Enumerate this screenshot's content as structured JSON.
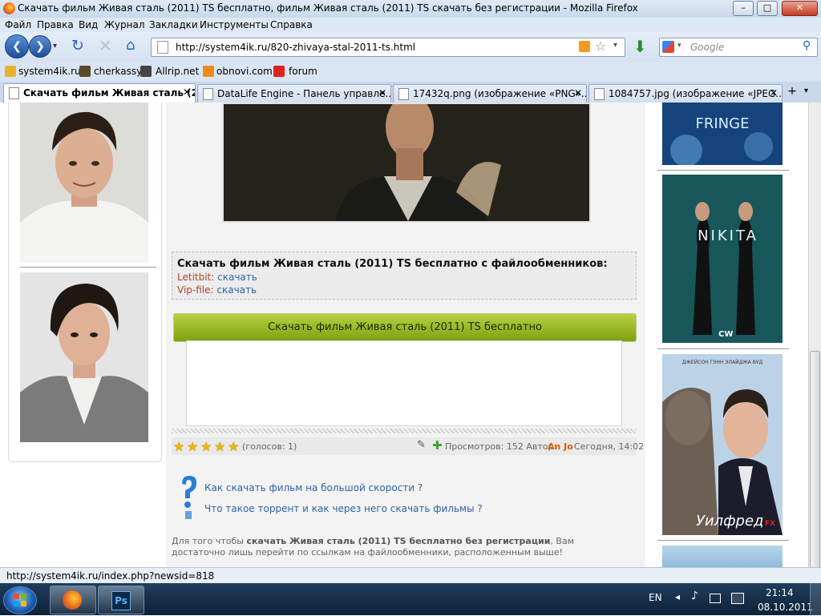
{
  "window": {
    "title": "Скачать фильм Живая сталь (2011) TS бесплатно, фильм Живая сталь (2011) TS скачать без регистрации - Mozilla Firefox",
    "min": "–",
    "max": "□",
    "close": "✕"
  },
  "menu": [
    "Файл",
    "Правка",
    "Вид",
    "Журнал",
    "Закладки",
    "Инструменты",
    "Справка"
  ],
  "nav": {
    "url": "http://system4ik.ru/820-zhivaya-stal-2011-ts.html",
    "search_placeholder": "Google",
    "back": "❮",
    "forward": "❯"
  },
  "bookmarks": [
    "system4ik.ru",
    "cherkassy",
    "Allrip.net",
    "obnovi.com",
    "forum"
  ],
  "tabs": [
    {
      "label": "Скачать фильм Живая сталь (2...",
      "close": "✕"
    },
    {
      "label": "DataLife Engine - Панель управле...",
      "close": "✕"
    },
    {
      "label": "17432q.png (изображение «PNG»...",
      "close": "✕"
    },
    {
      "label": "1084757.jpg (изображение «JPEG...",
      "close": "✕"
    }
  ],
  "download": {
    "heading": "Скачать фильм Живая сталь (2011) TS бесплатно с файлообменников:",
    "links": [
      {
        "host": "Letitbit:",
        "text": "скачать"
      },
      {
        "host": "Vip-file:",
        "text": "скачать"
      }
    ],
    "button": "Скачать фильм Живая сталь (2011) TS бесплатно"
  },
  "rating": {
    "stars": 5,
    "votes": "(голосов: 1)",
    "views": "Просмотров: 152 Автор:",
    "author": "An Jo",
    "date": "Сегодня, 14:02"
  },
  "help": {
    "q1": "Как скачать фильм на большой скорости ?",
    "q2": "Что такое торрент и как через него скачать фильмы ?"
  },
  "bottom": {
    "prefix": "Для того чтобы ",
    "bold": "скачать Живая сталь (2011) TS бесплатно без регистрации",
    "suffix": ", Вам достаточно лишь перейти по ссылкам на файлообменники, расположенным выше!"
  },
  "posters": {
    "fringe": "FRINGE",
    "nikita": "NIKITA",
    "cw": "CW",
    "wilfred_title": "Уилфред",
    "wilfred_actors": "ДЖЕЙСОН ГЭНН      ЭЛАЙДЖА ВУД",
    "fx": "FX"
  },
  "status": "http://system4ik.ru/index.php?newsid=818",
  "taskbar": {
    "lang": "EN",
    "time": "21:14",
    "date": "08.10.2011",
    "ps": "Ps"
  },
  "colors": {
    "accent_green": "#9cbb22",
    "link": "#2f62a7",
    "host": "#b3442a",
    "author": "#e25c00"
  }
}
